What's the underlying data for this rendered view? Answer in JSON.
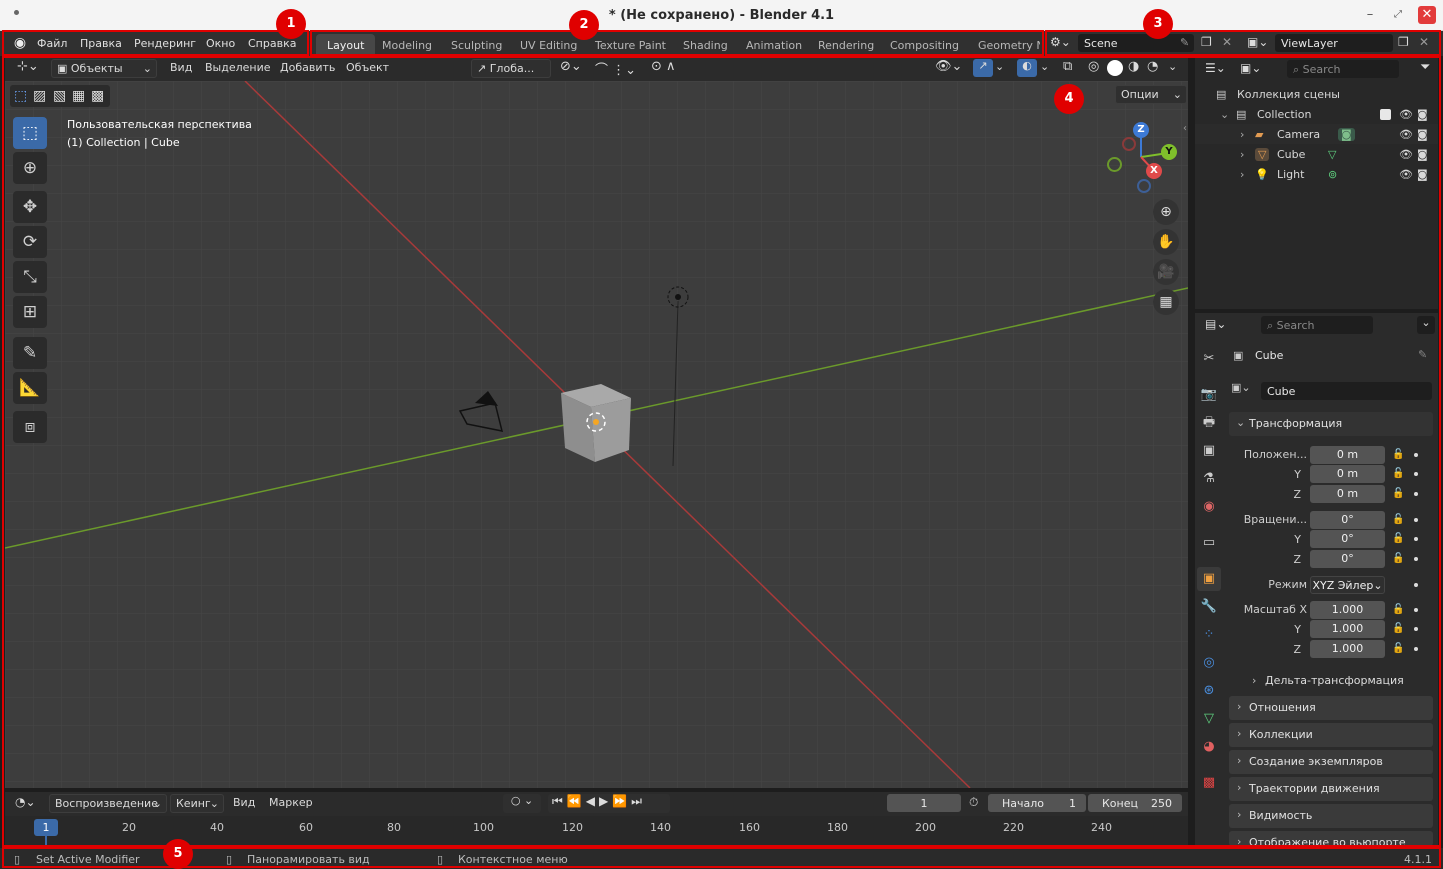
{
  "window": {
    "title": "* (Не сохранено) - Blender 4.1"
  },
  "menu": [
    "Файл",
    "Правка",
    "Рендеринг",
    "Окно",
    "Справка"
  ],
  "workspaces": [
    "Layout",
    "Modeling",
    "Sculpting",
    "UV Editing",
    "Texture Paint",
    "Shading",
    "Animation",
    "Rendering",
    "Compositing",
    "Geometry N"
  ],
  "scene": {
    "name": "Scene",
    "viewlayer": "ViewLayer"
  },
  "viewport_header": {
    "mode": "Объекты",
    "view": "Вид",
    "select": "Выделение",
    "add": "Добавить",
    "object": "Объект",
    "orientation": "Глоба...",
    "options": "Опции"
  },
  "viewport": {
    "perspective": "Пользовательская перспектива",
    "context": "(1) Collection | Cube",
    "axes": {
      "x": "X",
      "y": "Y",
      "z": "Z"
    }
  },
  "outliner": {
    "search_placeholder": "Search",
    "root": "Коллекция сцены",
    "collection": "Collection",
    "items": [
      "Camera",
      "Cube",
      "Light"
    ]
  },
  "properties": {
    "search_placeholder": "Search",
    "object_name": "Cube",
    "datablock": "Cube",
    "transform_title": "Трансформация",
    "location_label": "Положен...",
    "rotation_label": "Вращени...",
    "mode_label": "Режим",
    "mode_value": "XYZ Эйлер",
    "scale_label": "Масштаб X",
    "axis_y": "Y",
    "axis_z": "Z",
    "location": [
      "0 m",
      "0 m",
      "0 m"
    ],
    "rotation": [
      "0°",
      "0°",
      "0°"
    ],
    "scale": [
      "1.000",
      "1.000",
      "1.000"
    ],
    "delta": "Дельта-трансформация",
    "panels": [
      "Отношения",
      "Коллекции",
      "Создание экземпляров",
      "Траектории движения",
      "Видимость",
      "Отображение во вьюпорте"
    ]
  },
  "timeline": {
    "playback": "Воспроизведение",
    "keying": "Кеинг",
    "view": "Вид",
    "marker": "Маркер",
    "current_frame": "1",
    "start_label": "Начало",
    "start": "1",
    "end_label": "Конец",
    "end": "250",
    "ticks": [
      "1",
      "20",
      "40",
      "60",
      "80",
      "100",
      "120",
      "140",
      "160",
      "180",
      "200",
      "220",
      "240"
    ]
  },
  "status": {
    "left": "Set Active Modifier",
    "middle": "Панорамировать вид",
    "right": "Контекстное меню",
    "version": "4.1.1"
  },
  "annotations": [
    "1",
    "2",
    "3",
    "4",
    "5"
  ]
}
